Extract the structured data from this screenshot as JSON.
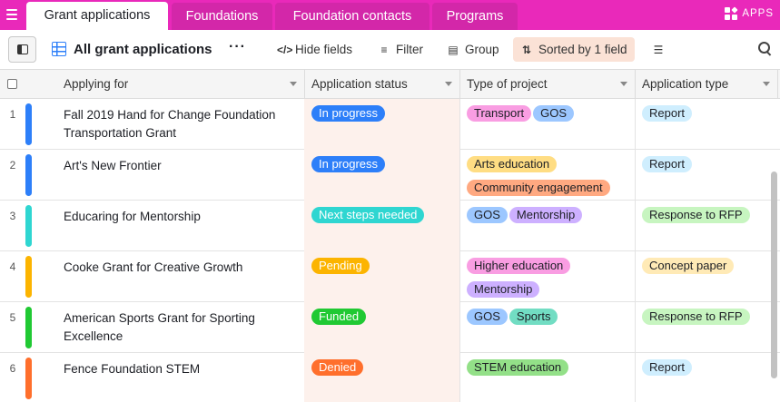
{
  "tabs": [
    {
      "label": "Grant applications",
      "active": true
    },
    {
      "label": "Foundations",
      "active": false
    },
    {
      "label": "Foundation contacts",
      "active": false
    },
    {
      "label": "Programs",
      "active": false
    }
  ],
  "apps_label": "APPS",
  "toolbar": {
    "view_name": "All grant applications",
    "more_label": "···",
    "hide_fields": "Hide fields",
    "filter": "Filter",
    "group": "Group",
    "sorted": "Sorted by 1 field"
  },
  "columns": [
    "Applying for",
    "Application status",
    "Type of project",
    "Application type"
  ],
  "colors": {
    "brand": "#e929ba",
    "accent_blue": "#2d7ff9",
    "sort_highlight": "#fbe2d6"
  },
  "rows": [
    {
      "num": "1",
      "bar_color": "#2d7ff9",
      "applying_for": "Fall 2019 Hand for Change Foundation Transportation Grant",
      "status": {
        "label": "In progress",
        "color": "#2d7ff9"
      },
      "project_types": [
        {
          "label": "Transport",
          "color": "#f99de2"
        },
        {
          "label": "GOS",
          "color": "#9cc7ff"
        }
      ],
      "app_type": {
        "label": "Report",
        "color": "#cfeefe"
      }
    },
    {
      "num": "2",
      "bar_color": "#2d7ff9",
      "applying_for": "Art's New Frontier",
      "status": {
        "label": "In progress",
        "color": "#2d7ff9"
      },
      "project_types": [
        {
          "label": "Arts education",
          "color": "#ffdd83"
        },
        {
          "label": "Community engagement",
          "color": "#ffa981"
        }
      ],
      "app_type": {
        "label": "Report",
        "color": "#cfeefe"
      }
    },
    {
      "num": "3",
      "bar_color": "#2fd6d1",
      "applying_for": "Educaring for Mentorship",
      "status": {
        "label": "Next steps needed",
        "color": "#2fd6d1"
      },
      "project_types": [
        {
          "label": "GOS",
          "color": "#9cc7ff"
        },
        {
          "label": "Mentorship",
          "color": "#cdb0ff"
        }
      ],
      "app_type": {
        "label": "Response to RFP",
        "color": "#c7f5c0"
      }
    },
    {
      "num": "4",
      "bar_color": "#fcb400",
      "applying_for": "Cooke Grant for Creative Growth",
      "status": {
        "label": "Pending",
        "color": "#fcb400"
      },
      "project_types": [
        {
          "label": "Higher education",
          "color": "#f99de2"
        },
        {
          "label": "Mentorship",
          "color": "#cdb0ff"
        }
      ],
      "app_type": {
        "label": "Concept paper",
        "color": "#ffeab6"
      }
    },
    {
      "num": "5",
      "bar_color": "#20c933",
      "applying_for": "American Sports Grant for Sporting Excellence",
      "status": {
        "label": "Funded",
        "color": "#20c933"
      },
      "project_types": [
        {
          "label": "GOS",
          "color": "#9cc7ff"
        },
        {
          "label": "Sports",
          "color": "#72ddc3"
        }
      ],
      "app_type": {
        "label": "Response to RFP",
        "color": "#c7f5c0"
      }
    },
    {
      "num": "6",
      "bar_color": "#ff6f2c",
      "applying_for": "Fence Foundation STEM",
      "status": {
        "label": "Denied",
        "color": "#ff6f2c"
      },
      "project_types": [
        {
          "label": "STEM education",
          "color": "#93e088"
        }
      ],
      "app_type": {
        "label": "Report",
        "color": "#cfeefe"
      }
    }
  ]
}
